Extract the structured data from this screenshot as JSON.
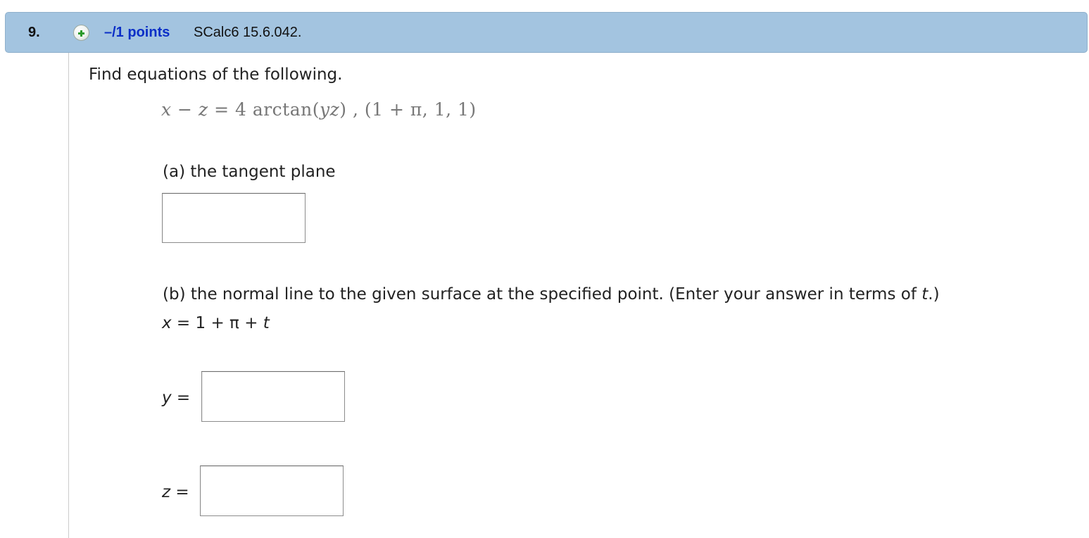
{
  "question": {
    "number": "9.",
    "points": "–/1 points",
    "source": "SCalc6 15.6.042."
  },
  "prompt": "Find equations of the following.",
  "equation": {
    "var_x": "x",
    "minus": " − ",
    "var_z": "z",
    "equals": " = 4 arctan(",
    "var_yz": "yz",
    "rest": ") ,  (1 + π, 1, 1)"
  },
  "part_a": {
    "label": "(a) the tangent plane",
    "value": ""
  },
  "part_b": {
    "label_prefix": "(b) the normal line to the given surface at the specified point. (Enter your answer in terms of ",
    "label_var": "t",
    "label_suffix": ".)",
    "x_var": "x",
    "x_expr": " = 1 + π + ",
    "x_t": "t",
    "y_var": "y",
    "y_eq": " =",
    "y_value": "",
    "z_var": "z",
    "z_eq": " =",
    "z_value": ""
  },
  "colors": {
    "header_bg": "#a3c4e0",
    "points_link": "#0b2fc7",
    "plus_icon": "#2a9a2a"
  }
}
